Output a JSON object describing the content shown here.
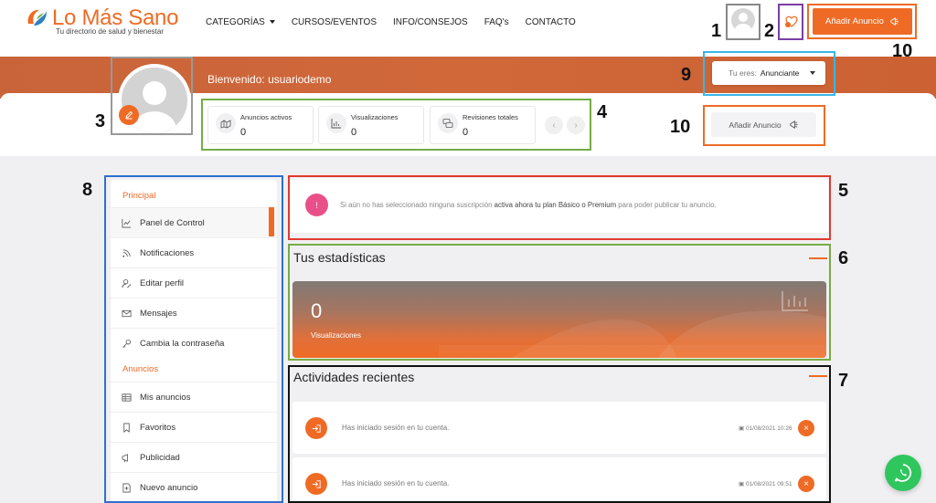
{
  "colors": {
    "accent": "#ef6b25",
    "banner": "#cc6536",
    "alert_dot": "#e9508a",
    "whatsapp": "#2fc65e"
  },
  "header": {
    "logo_text": "Lo Más Sano",
    "logo_tagline": "Tu directorio de salud y bienestar",
    "nav": [
      "CATEGORÍAS",
      "CURSOS/EVENTOS",
      "INFO/CONSEJOS",
      "FAQ's",
      "CONTACTO"
    ],
    "add_listing_label": "Añadir Anuncio"
  },
  "profile": {
    "welcome_prefix": "Bienvenido:",
    "username": "usuariodemo",
    "role_label": "Tu eres:",
    "role_value": "Anunciante",
    "stats": [
      {
        "label": "Anuncios activos",
        "value": "0",
        "icon": "listings-icon"
      },
      {
        "label": "Visualizaciones",
        "value": "0",
        "icon": "bar-chart-icon"
      },
      {
        "label": "Revisiones totales",
        "value": "0",
        "icon": "reviews-icon"
      }
    ],
    "add_listing_label": "Añadir Anuncio"
  },
  "sidebar": {
    "sections": [
      {
        "title": "Principal",
        "items": [
          "Panel de Control",
          "Notificaciones",
          "Editar perfil",
          "Mensajes",
          "Cambia la contraseña"
        ]
      },
      {
        "title": "Anuncios",
        "items": [
          "Mis anuncios",
          "Favoritos",
          "Publicidad",
          "Nuevo anuncio"
        ]
      }
    ],
    "active_item": "Panel de Control"
  },
  "alert": {
    "part1": "Si aún no has seleccionado ninguna suscripción",
    "part2": "activa ahora tu plan Básico o Premium",
    "part3": "para poder publicar tu anuncio."
  },
  "stats_section": {
    "title": "Tus estadísticas",
    "value": "0",
    "label": "Visualizaciones"
  },
  "activity": {
    "title": "Actividades recientes",
    "items": [
      {
        "text": "Has iniciado sesión en tu cuenta.",
        "date": "01/08/2021 10:26"
      },
      {
        "text": "Has iniciado sesión en tu cuenta.",
        "date": "01/08/2021 09:51"
      }
    ]
  },
  "annotations": {
    "n1": "1",
    "n2": "2",
    "n3": "3",
    "n4": "4",
    "n5": "5",
    "n6": "6",
    "n7": "7",
    "n8": "8",
    "n9": "9",
    "n10a": "10",
    "n10b": "10"
  }
}
